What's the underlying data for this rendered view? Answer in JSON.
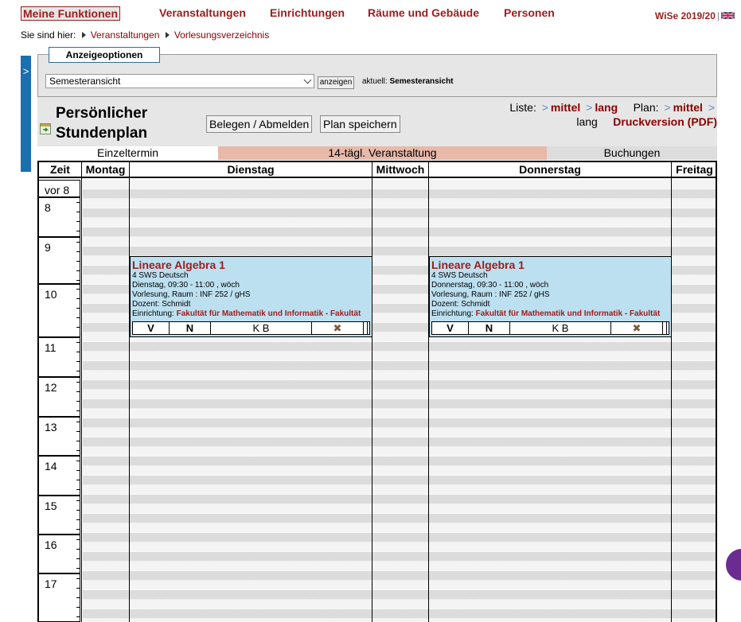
{
  "nav": {
    "items": [
      "Meine Funktionen",
      "Veranstaltungen",
      "Einrichtungen",
      "Räume und Gebäude",
      "Personen"
    ],
    "semester": "WiSe 2019/20"
  },
  "breadcrumb": {
    "prefix": "Sie sind hier:",
    "items": [
      "Veranstaltungen",
      "Vorlesungsverzeichnis"
    ]
  },
  "sidetab": {
    "label": ">"
  },
  "options": {
    "tab_label": "Anzeigeoptionen",
    "view_select": "Semesteransicht",
    "show_button": "anzeigen",
    "current_label": "aktuell:",
    "current_value": "Semesteransicht"
  },
  "plan": {
    "title_line1": "Persönlicher",
    "title_line2": "Stundenplan",
    "btn_enroll": "Belegen / Abmelden",
    "btn_save": "Plan speichern",
    "liste_label": "Liste:",
    "liste_medium": "mittel",
    "liste_long": "lang",
    "plan_label": "Plan:",
    "plan_medium": "mittel",
    "plan_long": "lang",
    "print": "Druckversion (PDF)"
  },
  "legend": {
    "single": "Einzeltermin",
    "biweekly": "14-tägl. Veranstaltung",
    "bookings": "Buchungen",
    "colors": {
      "single": "#ffffff",
      "biweekly": "#e8b8a8",
      "bookings": "#dddddd"
    }
  },
  "columns": [
    "Zeit",
    "Montag",
    "Dienstag",
    "Mittwoch",
    "Donnerstag",
    "Freitag"
  ],
  "hours": [
    "vor 8",
    "8",
    "9",
    "10",
    "11",
    "12",
    "13",
    "14",
    "15",
    "16",
    "17"
  ],
  "events": [
    {
      "title": "Lineare Algebra 1",
      "sws": "4 SWS   Deutsch",
      "time": "Dienstag,  09:30 - 11:00 , wöch",
      "room": "Vorlesung, Raum : INF 252 / gHS",
      "lecturer": "Dozent: Schmidt",
      "inst_label": "Einrichtung:",
      "institution": "Fakultät für Mathematik und Informatik - Fakultät",
      "actions": [
        "V",
        "N",
        "K B"
      ]
    },
    {
      "title": "Lineare Algebra 1",
      "sws": "4 SWS   Deutsch",
      "time": "Donnerstag,  09:30 - 11:00 , wöch",
      "room": "Vorlesung, Raum : INF 252 / gHS",
      "lecturer": "Dozent: Schmidt",
      "inst_label": "Einrichtung:",
      "institution": "Fakultät für Mathematik und Informatik - Fakultät",
      "actions": [
        "V",
        "N",
        "K B"
      ]
    }
  ],
  "colors": {
    "accent": "#9c1d1d",
    "event_bg": "#bde0f0",
    "sidetab": "#1a6fb0"
  }
}
